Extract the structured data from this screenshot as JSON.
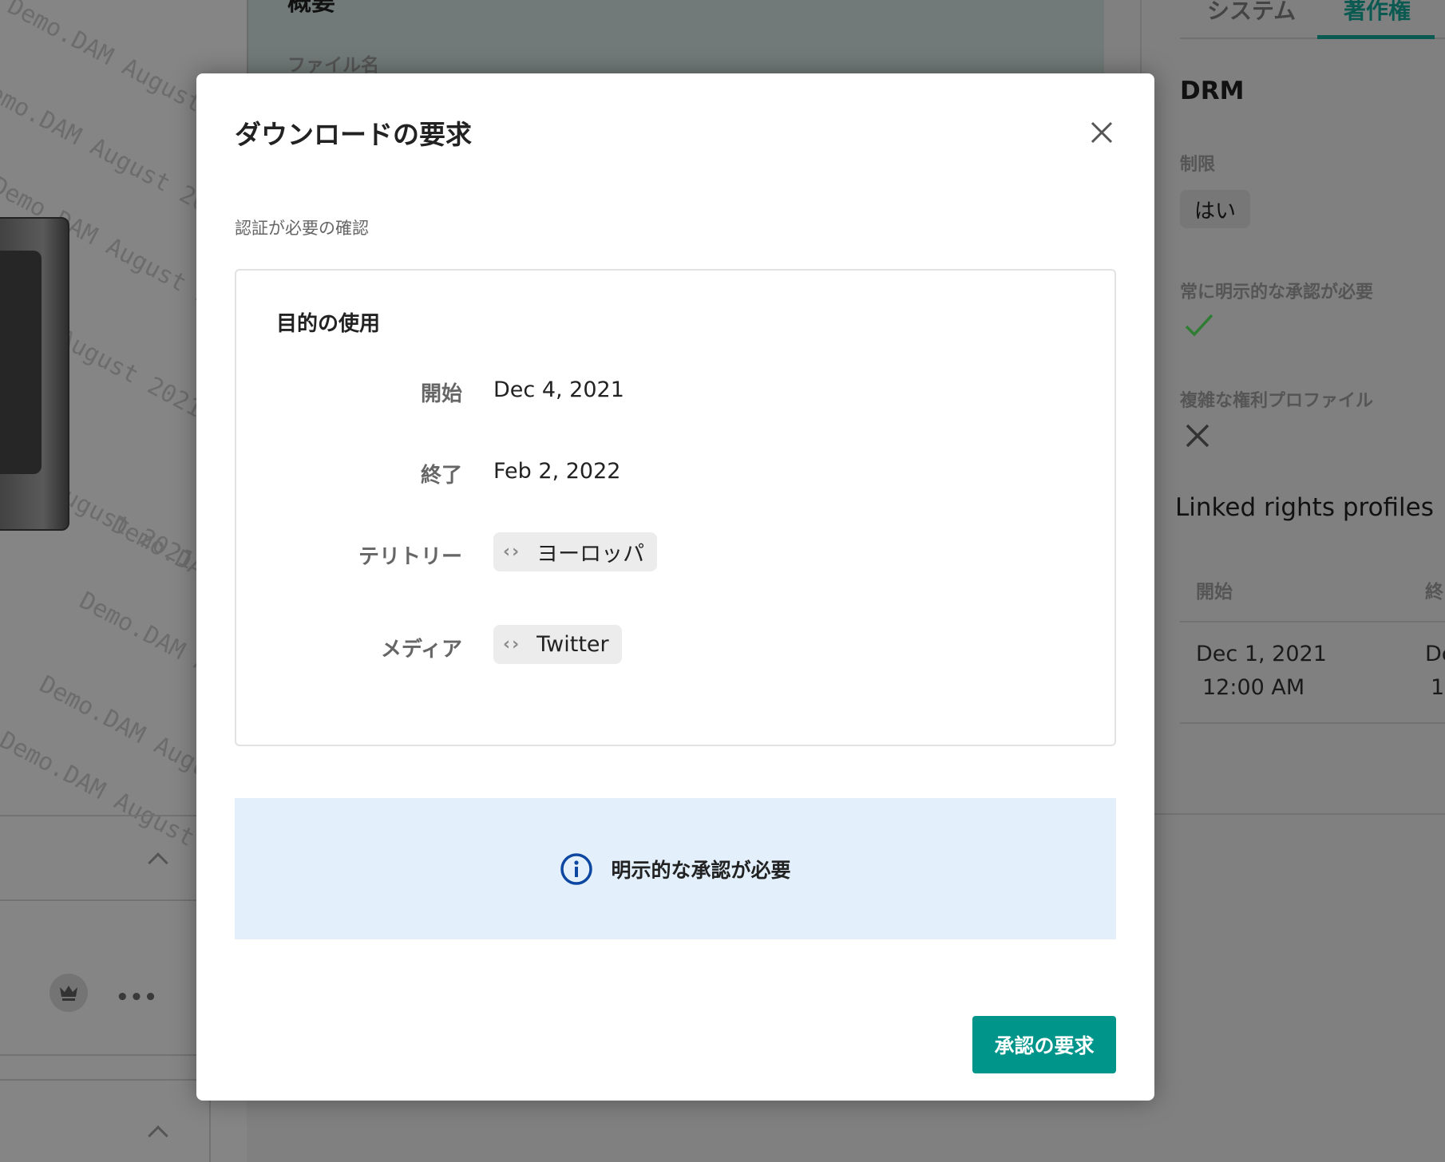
{
  "background": {
    "watermark_text": "Demo.DAM August 2021",
    "middle_panel": {
      "title": "概要",
      "file_name_label": "ファイル名"
    },
    "right_panel": {
      "tabs": [
        {
          "label": "システム",
          "active": false
        },
        {
          "label": "著作権",
          "active": true
        }
      ],
      "drm_heading": "DRM",
      "restriction_label": "制限",
      "restriction_value": "はい",
      "always_explicit_label": "常に明示的な承認が必要",
      "always_explicit_value": "check-icon",
      "complex_profile_label": "複雑な権利プロファイル",
      "complex_profile_value": "x-icon",
      "linked_heading": "Linked rights profiles",
      "table": {
        "headers": [
          "開始",
          "終"
        ],
        "rows": [
          {
            "start_date": "Dec 1, 2021",
            "start_time": "12:00 AM",
            "end_date": "De",
            "end_time": "1:"
          }
        ]
      }
    }
  },
  "modal": {
    "title": "ダウンロードの要求",
    "subtitle": "認証が必要の確認",
    "card": {
      "title": "目的の使用",
      "rows": [
        {
          "label": "開始",
          "value": "Dec 4, 2021"
        },
        {
          "label": "終了",
          "value": "Feb 2, 2022"
        },
        {
          "label": "テリトリー",
          "value": "ヨーロッパ",
          "chip": true
        },
        {
          "label": "メディア",
          "value": "Twitter",
          "chip": true
        }
      ]
    },
    "chip_icon": "‹›",
    "info_banner": "明示的な承認が必要",
    "submit_label": "承認の要求"
  },
  "colors": {
    "accent": "#00958a",
    "active_tab": "#0a5a52",
    "info_bg": "#e3f0fb",
    "info_icon": "#0d47a1"
  }
}
